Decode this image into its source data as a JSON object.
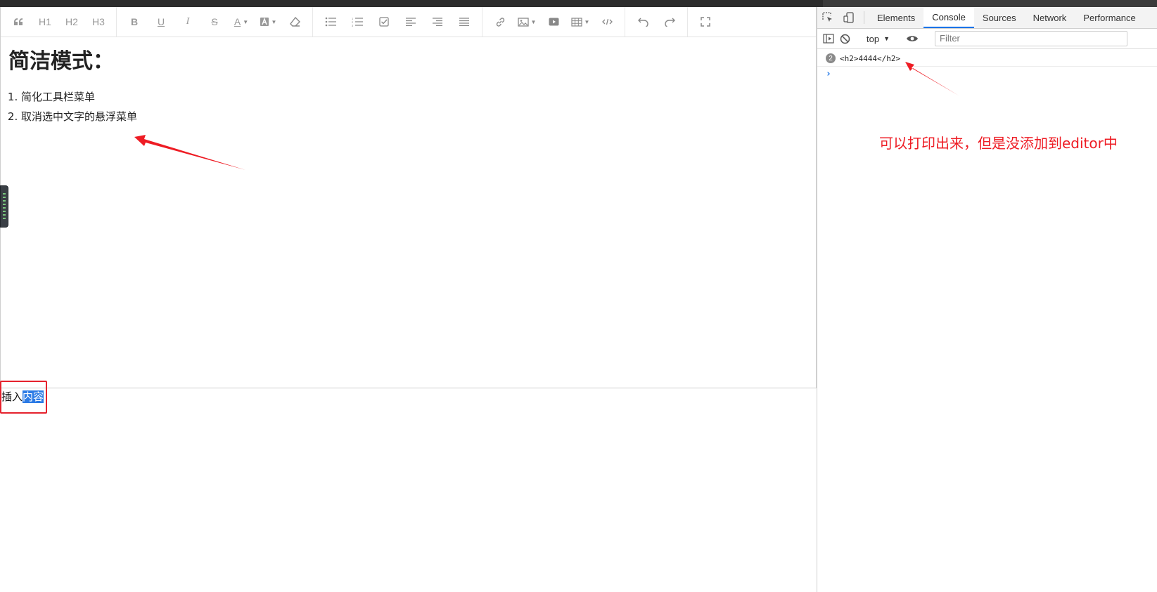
{
  "editor": {
    "toolbar": {
      "groups": [
        {
          "items": [
            {
              "name": "blockquote-button",
              "label": "“"
            },
            {
              "name": "h1-button",
              "label": "H1"
            },
            {
              "name": "h2-button",
              "label": "H2"
            },
            {
              "name": "h3-button",
              "label": "H3"
            }
          ]
        },
        {
          "items": [
            {
              "name": "bold-button",
              "label": "B"
            },
            {
              "name": "underline-button",
              "label": "U"
            },
            {
              "name": "italic-button",
              "label": "I"
            },
            {
              "name": "strikethrough-button",
              "label": "S"
            },
            {
              "name": "font-color-button",
              "label": "A"
            },
            {
              "name": "background-color-button",
              "label": "A"
            },
            {
              "name": "clear-format-button",
              "icon": "eraser-icon"
            }
          ]
        }
      ]
    },
    "heading": "简洁模式：",
    "list_items": [
      "简化工具栏菜单",
      "取消选中文字的悬浮菜单"
    ],
    "insert_text": {
      "prefix": "插入",
      "selected": "内容"
    }
  },
  "devtools": {
    "tabs": [
      "Elements",
      "Console",
      "Sources",
      "Network",
      "Performance"
    ],
    "active_tab": "Console",
    "context": "top",
    "filter_placeholder": "Filter",
    "console": {
      "count": "2",
      "message": "<h2>4444</h2>",
      "prompt": "›"
    }
  },
  "annotation": "可以打印出来，但是没添加到editor中",
  "colors": {
    "annotation_red": "#ee1c24",
    "selection_blue": "#2c7be5",
    "devtools_active": "#1a73e8"
  }
}
